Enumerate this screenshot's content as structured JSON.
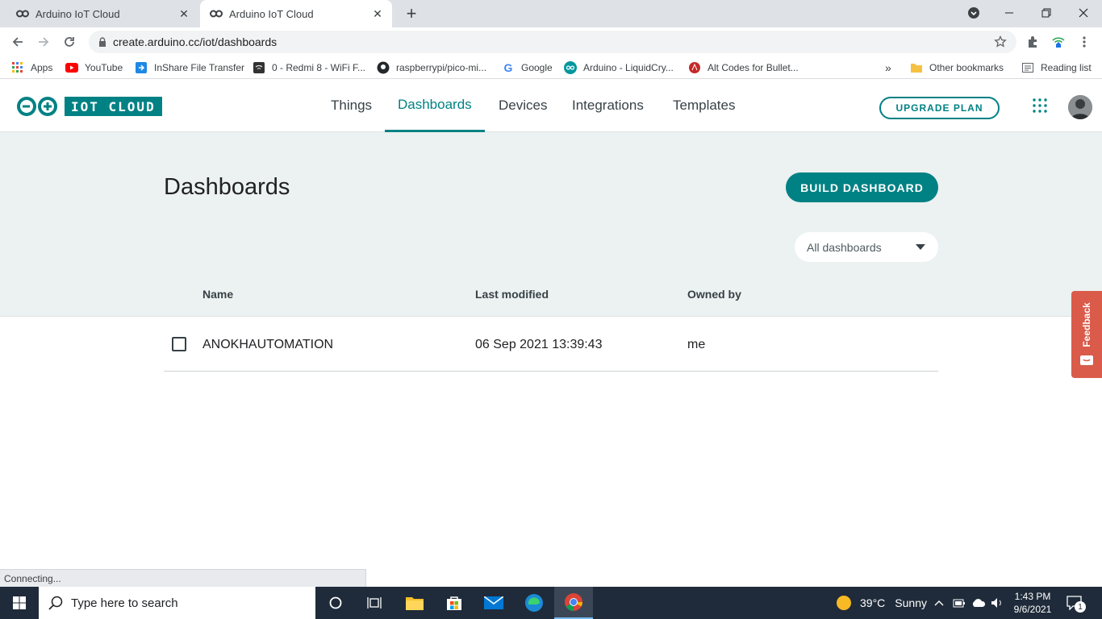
{
  "browser": {
    "tabs": [
      {
        "title": "Arduino IoT Cloud",
        "icon": "arduino-icon",
        "active": false
      },
      {
        "title": "Arduino IoT Cloud",
        "icon": "arduino-icon",
        "active": true
      }
    ],
    "url": "create.arduino.cc/iot/dashboards",
    "bookmarks": [
      {
        "label": "Apps",
        "icon": "apps-grid-icon"
      },
      {
        "label": "YouTube",
        "icon": "youtube-icon"
      },
      {
        "label": "InShare File Transfer",
        "icon": "inshare-icon"
      },
      {
        "label": "0 - Redmi 8 - WiFi F...",
        "icon": "router-icon"
      },
      {
        "label": "raspberrypi/pico-mi...",
        "icon": "github-icon"
      },
      {
        "label": "Google",
        "icon": "google-icon"
      },
      {
        "label": "Arduino - LiquidCry...",
        "icon": "arduino-icon"
      },
      {
        "label": "Alt Codes for Bullet...",
        "icon": "altcodes-icon"
      }
    ],
    "more_bookmarks": "»",
    "other_bookmarks": "Other bookmarks",
    "reading_list": "Reading list",
    "status_text": "Connecting..."
  },
  "app": {
    "logo_text": "IOT CLOUD",
    "nav": [
      "Things",
      "Dashboards",
      "Devices",
      "Integrations",
      "Templates"
    ],
    "active_nav": "Dashboards",
    "upgrade_label": "UPGRADE PLAN"
  },
  "page": {
    "title": "Dashboards",
    "build_button": "BUILD DASHBOARD",
    "filter_value": "All dashboards",
    "columns": {
      "name": "Name",
      "modified": "Last modified",
      "owner": "Owned by"
    },
    "rows": [
      {
        "name": "ANOKHAUTOMATION",
        "modified": "06 Sep 2021 13:39:43",
        "owner": "me",
        "checked": false
      }
    ],
    "feedback_label": "Feedback"
  },
  "taskbar": {
    "search_placeholder": "Type here to search",
    "weather": "39°C",
    "weather_desc": "Sunny",
    "time": "1:43 PM",
    "date": "9/6/2021",
    "notification_count": "1"
  },
  "colors": {
    "accent": "#008184",
    "feedback": "#da5b4a",
    "header_bg": "#ecf1f1",
    "taskbar": "#1f2b3a"
  }
}
